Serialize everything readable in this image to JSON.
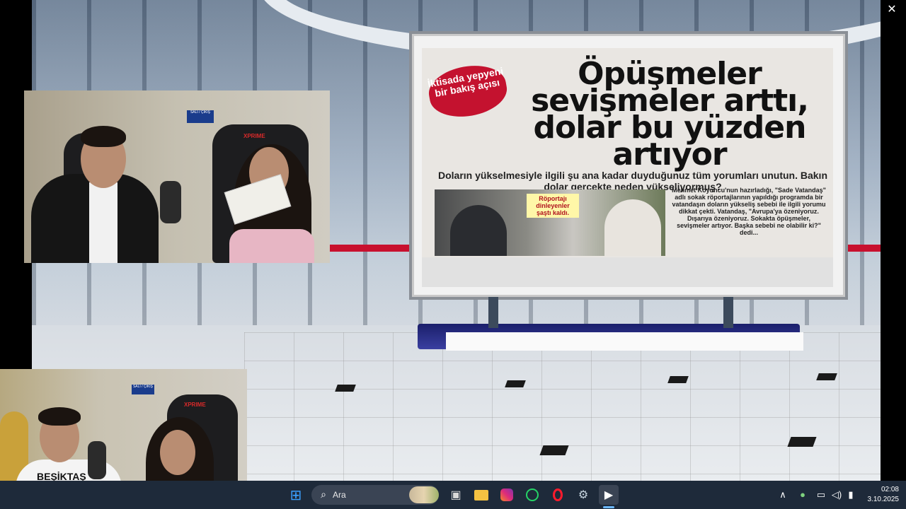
{
  "window": {
    "close_label": "✕"
  },
  "newspaper": {
    "badge": "İktisada yepyeni bir bakış açısı",
    "headline": "Öpüşmeler sevişmeler arttı, dolar bu yüzden artıyor",
    "subline": "Doların yükselmesiyle ilgili şu ana kadar duyduğunuz tüm yorumları unutun. Bakın dolar gerçekte neden yükseliyormuş?",
    "photo_caption": "Röportajı dinleyenler şaştı kaldı.",
    "body": "Mehmet Koyuncu'nun hazırladığı, \"Sade Vatandaş\" adlı sokak röportajlarının yapıldığı programda bir vatandaşın doların yükseliş sebebi ile ilgili yorumu dikkat çekti. Vatandaş, \"Avrupa'ya özeniyoruz. Dışarıya özeniyoruz. Sokakta öpüşmeler, sevişmeler artıyor. Başka sebebi ne olabilir ki?\" dedi..."
  },
  "cam1": {
    "chair_brand": "XPRIME",
    "sign": "SALI / ÇIKIŞ"
  },
  "cam2": {
    "chair_brand": "XPRIME",
    "jersey_text": "BEŞİKTAŞ",
    "sign": "SALI / ÇIKIŞ"
  },
  "taskbar": {
    "search_placeholder": "Ara",
    "apps": [
      {
        "name": "windows-start",
        "glyph": "⊞",
        "color": "#3aa0ff"
      },
      {
        "name": "task-view",
        "glyph": "▣",
        "color": "#d9d9d9"
      },
      {
        "name": "file-explorer",
        "glyph": "📁",
        "color": "#f5c242"
      },
      {
        "name": "instagram",
        "glyph": "◎",
        "color": "#e1306c"
      },
      {
        "name": "whatsapp",
        "glyph": "✆",
        "color": "#25d366"
      },
      {
        "name": "opera",
        "glyph": "O",
        "color": "#ff1b2d"
      },
      {
        "name": "steam-app",
        "glyph": "⚙",
        "color": "#c7d5e0"
      },
      {
        "name": "media-player",
        "glyph": "▶",
        "color": "#ffffff"
      }
    ],
    "tray": {
      "chevron": "∧",
      "mic": "🎤",
      "display": "▭",
      "volume": "🔊",
      "battery": "▮"
    },
    "time": "02:08",
    "date": "3.10.2025"
  },
  "colors": {
    "taskbar": "#1e2a3a",
    "accent_red": "#c8102e"
  }
}
